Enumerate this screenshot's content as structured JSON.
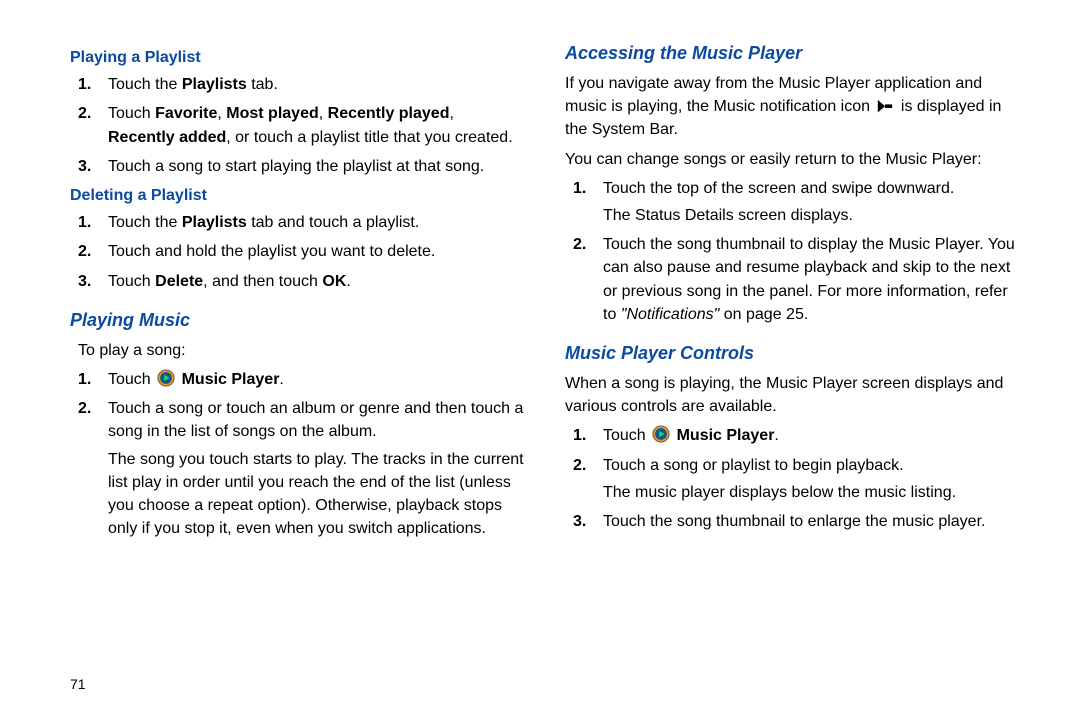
{
  "page_number": "71",
  "left": {
    "h_play_pl": "Playing a Playlist",
    "pl1_a": "Touch the ",
    "pl1_b": "Playlists",
    "pl1_c": " tab.",
    "pl2_a": "Touch ",
    "pl2_b": "Favorite",
    "pl2_c": ", ",
    "pl2_d": "Most played",
    "pl2_e": ", ",
    "pl2_f": "Recently played",
    "pl2_g": ", ",
    "pl2_h": "Recently added",
    "pl2_i": ", or touch a playlist title that you created.",
    "pl3": "Touch a song to start playing the playlist at that song.",
    "h_del_pl": "Deleting a Playlist",
    "dl1_a": "Touch the ",
    "dl1_b": "Playlists",
    "dl1_c": " tab and touch a playlist.",
    "dl2": "Touch and hold the playlist you want to delete.",
    "dl3_a": "Touch ",
    "dl3_b": "Delete",
    "dl3_c": ", and then touch ",
    "dl3_d": "OK",
    "dl3_e": ".",
    "h_play_music": "Playing Music",
    "pm_intro": "To play a song:",
    "pm1_a": "Touch ",
    "pm1_b": " Music Player",
    "pm1_c": ".",
    "pm2": "Touch a song or touch an album or genre and then touch a song in the list of songs on the album.",
    "pm2_cont": "The song you touch starts to play. The tracks in the current list play in order until you reach the end of the list (unless you choose a repeat option). Otherwise, playback stops only if you stop it, even when you switch applications."
  },
  "right": {
    "h_access": "Accessing the Music Player",
    "ac_p1_a": "If you navigate away from the Music Player application and music is playing, the Music notification icon ",
    "ac_p1_b": " is displayed in the System Bar.",
    "ac_p2": "You can change songs or easily return to the Music Player:",
    "ac1": "Touch the top of the screen and swipe downward.",
    "ac1_cont": "The Status Details screen displays.",
    "ac2_a": "Touch the song thumbnail to display the Music Player. You can also pause and resume playback and skip to the next or previous song in the panel. For more information, refer to ",
    "ac2_b": "\"Notifications\"",
    "ac2_c": " on page 25.",
    "h_controls": "Music Player Controls",
    "mc_p1": "When a song is playing, the Music Player screen displays and various controls are available.",
    "mc1_a": "Touch ",
    "mc1_b": " Music Player",
    "mc1_c": ".",
    "mc2": "Touch a song or playlist to begin playback.",
    "mc2_cont": "The music player displays below the music listing.",
    "mc3": "Touch the song thumbnail to enlarge the music player."
  }
}
